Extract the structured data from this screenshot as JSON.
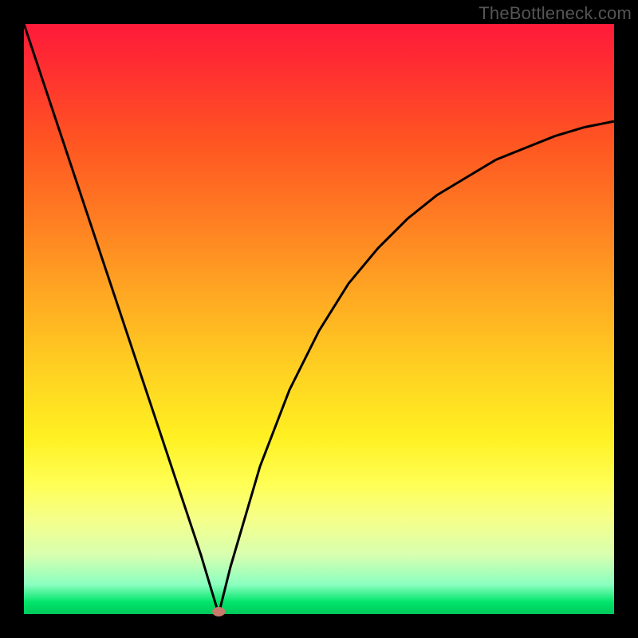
{
  "watermark": "TheBottleneck.com",
  "chart_data": {
    "type": "line",
    "title": "",
    "xlabel": "",
    "ylabel": "",
    "xlim": [
      0,
      100
    ],
    "ylim": [
      0,
      100
    ],
    "grid": false,
    "legend": false,
    "minimum_point": {
      "x": 33,
      "y": 0
    },
    "series": [
      {
        "name": "bottleneck-curve",
        "x": [
          0,
          5,
          10,
          15,
          20,
          25,
          30,
          33,
          35,
          40,
          45,
          50,
          55,
          60,
          65,
          70,
          75,
          80,
          85,
          90,
          95,
          100
        ],
        "values": [
          100,
          85,
          70,
          55,
          40,
          25,
          10,
          0,
          8,
          25,
          38,
          48,
          56,
          62,
          67,
          71,
          74,
          77,
          79,
          81,
          82.5,
          83.5
        ]
      }
    ]
  }
}
